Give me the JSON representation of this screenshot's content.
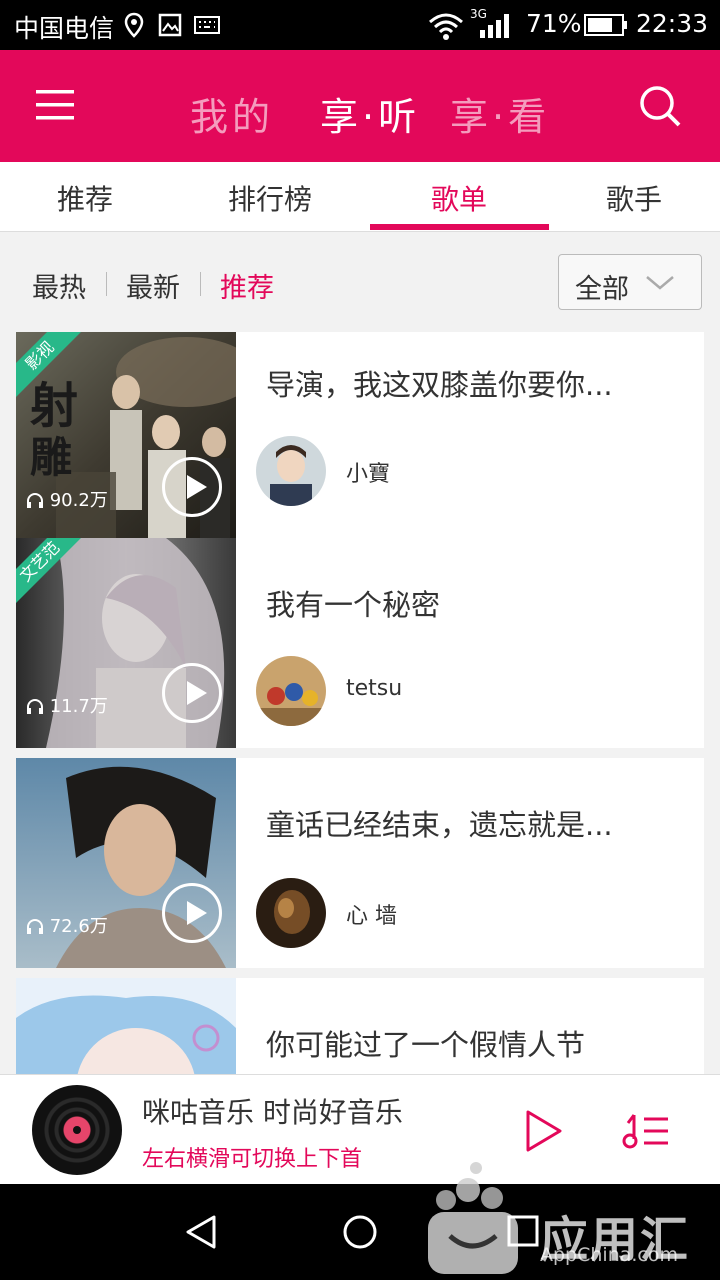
{
  "status_bar": {
    "carrier": "中国电信",
    "network": "3G",
    "battery": "71%",
    "time": "22:33"
  },
  "header": {
    "tabs": [
      {
        "label": "我的"
      },
      {
        "label": "享·听"
      },
      {
        "label": "享·看"
      }
    ],
    "active_tab": 1,
    "accent_color": "#e3085a"
  },
  "subtabs": {
    "items": [
      {
        "label": "推荐"
      },
      {
        "label": "排行榜"
      },
      {
        "label": "歌单"
      },
      {
        "label": "歌手"
      }
    ],
    "active": 2
  },
  "filters": {
    "items": [
      {
        "label": "最热"
      },
      {
        "label": "最新"
      },
      {
        "label": "推荐"
      }
    ],
    "active": 2,
    "dropdown_value": "全部"
  },
  "playlists": [
    {
      "title": "导演，我这双膝盖你要你...",
      "user": "小寶",
      "listens": "90.2万",
      "badge": "影视"
    },
    {
      "title": "我有一个秘密",
      "user": "tetsu",
      "listens": "11.7万",
      "badge": "文艺范"
    },
    {
      "title": "童话已经结束，遗忘就是...",
      "user": "心 墙",
      "listens": "72.6万"
    },
    {
      "title": "你可能过了一个假情人节"
    }
  ],
  "player": {
    "title": "咪咕音乐 时尚好音乐",
    "subtitle": "左右横滑可切换上下首"
  },
  "watermark": {
    "text": "应用汇",
    "url": "AppChina.com"
  }
}
